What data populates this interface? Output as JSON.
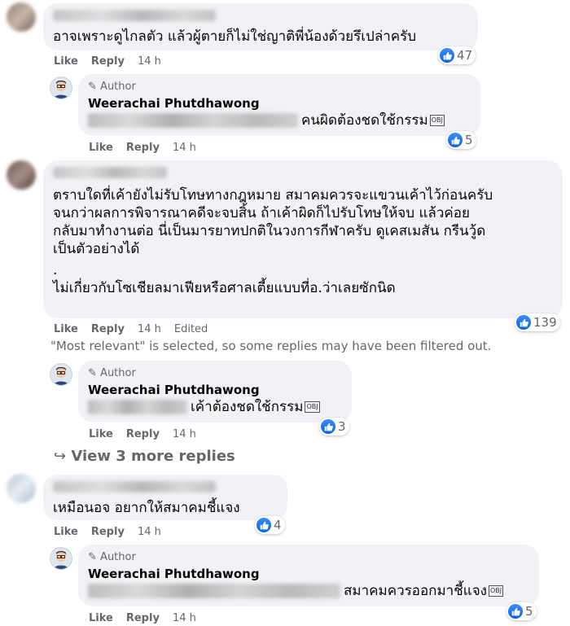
{
  "actions": {
    "like": "Like",
    "reply": "Reply",
    "edited": "Edited"
  },
  "author_badge": "Author",
  "author_name": "Weerachai Phutdhawong",
  "obj_glyph": "OBJ",
  "comments": [
    {
      "text": "อาจเพราะดูไกลตัว แล้วผู้ตายก็ไม่ใช่ญาติพี่น้องด้วยรึเปล่าครับ",
      "time": "14 h",
      "reactions": "47"
    },
    {
      "text_lines": [
        "ตราบใดที่เค้ายังไม่รับโทษทางกฎหมาย สมาคมควรจะแขวนเค้าไว้ก่อนครับ",
        "จนกว่าผลการพิจารณาคดีจะจบสิ้น ถ้าเค้าผิดก็ไปรับโทษให้จบ แล้วค่อย",
        "กลับมาทำงานต่อ นี่เป็นมารยาทปกติในวงการกีฬาครับ ดูเคสเมสัน กรีนวู้ด",
        "เป็นตัวอย่างได้",
        ".",
        "ไม่เกี่ยวกับโซเชียลมาเฟียหรือศาลเตี้ยแบบที่อ.ว่าเลยซักนิด"
      ],
      "time": "14 h",
      "reactions": "139"
    },
    {
      "text": "เหมือนอจ อยากให้สมาคมชี้แจง",
      "time": "14 h",
      "reactions": "4"
    }
  ],
  "replies": [
    {
      "text": "คนผิดต้องชดใช้กรรม",
      "time": "14 h",
      "reactions": "5"
    },
    {
      "text": "เค้าต้องชดใช้กรรม",
      "time": "14 h",
      "reactions": "3"
    },
    {
      "text": "สมาคมควรออกมาชี้แจง",
      "time": "14 h",
      "reactions": "5"
    }
  ],
  "notice": "\"Most relevant\" is selected, so some replies may have been filtered out.",
  "view_more": "View 3 more replies",
  "colors": {
    "like_blue": "#0866ff",
    "bubble": "#f0f2f5",
    "meta_gray": "#65676b"
  }
}
